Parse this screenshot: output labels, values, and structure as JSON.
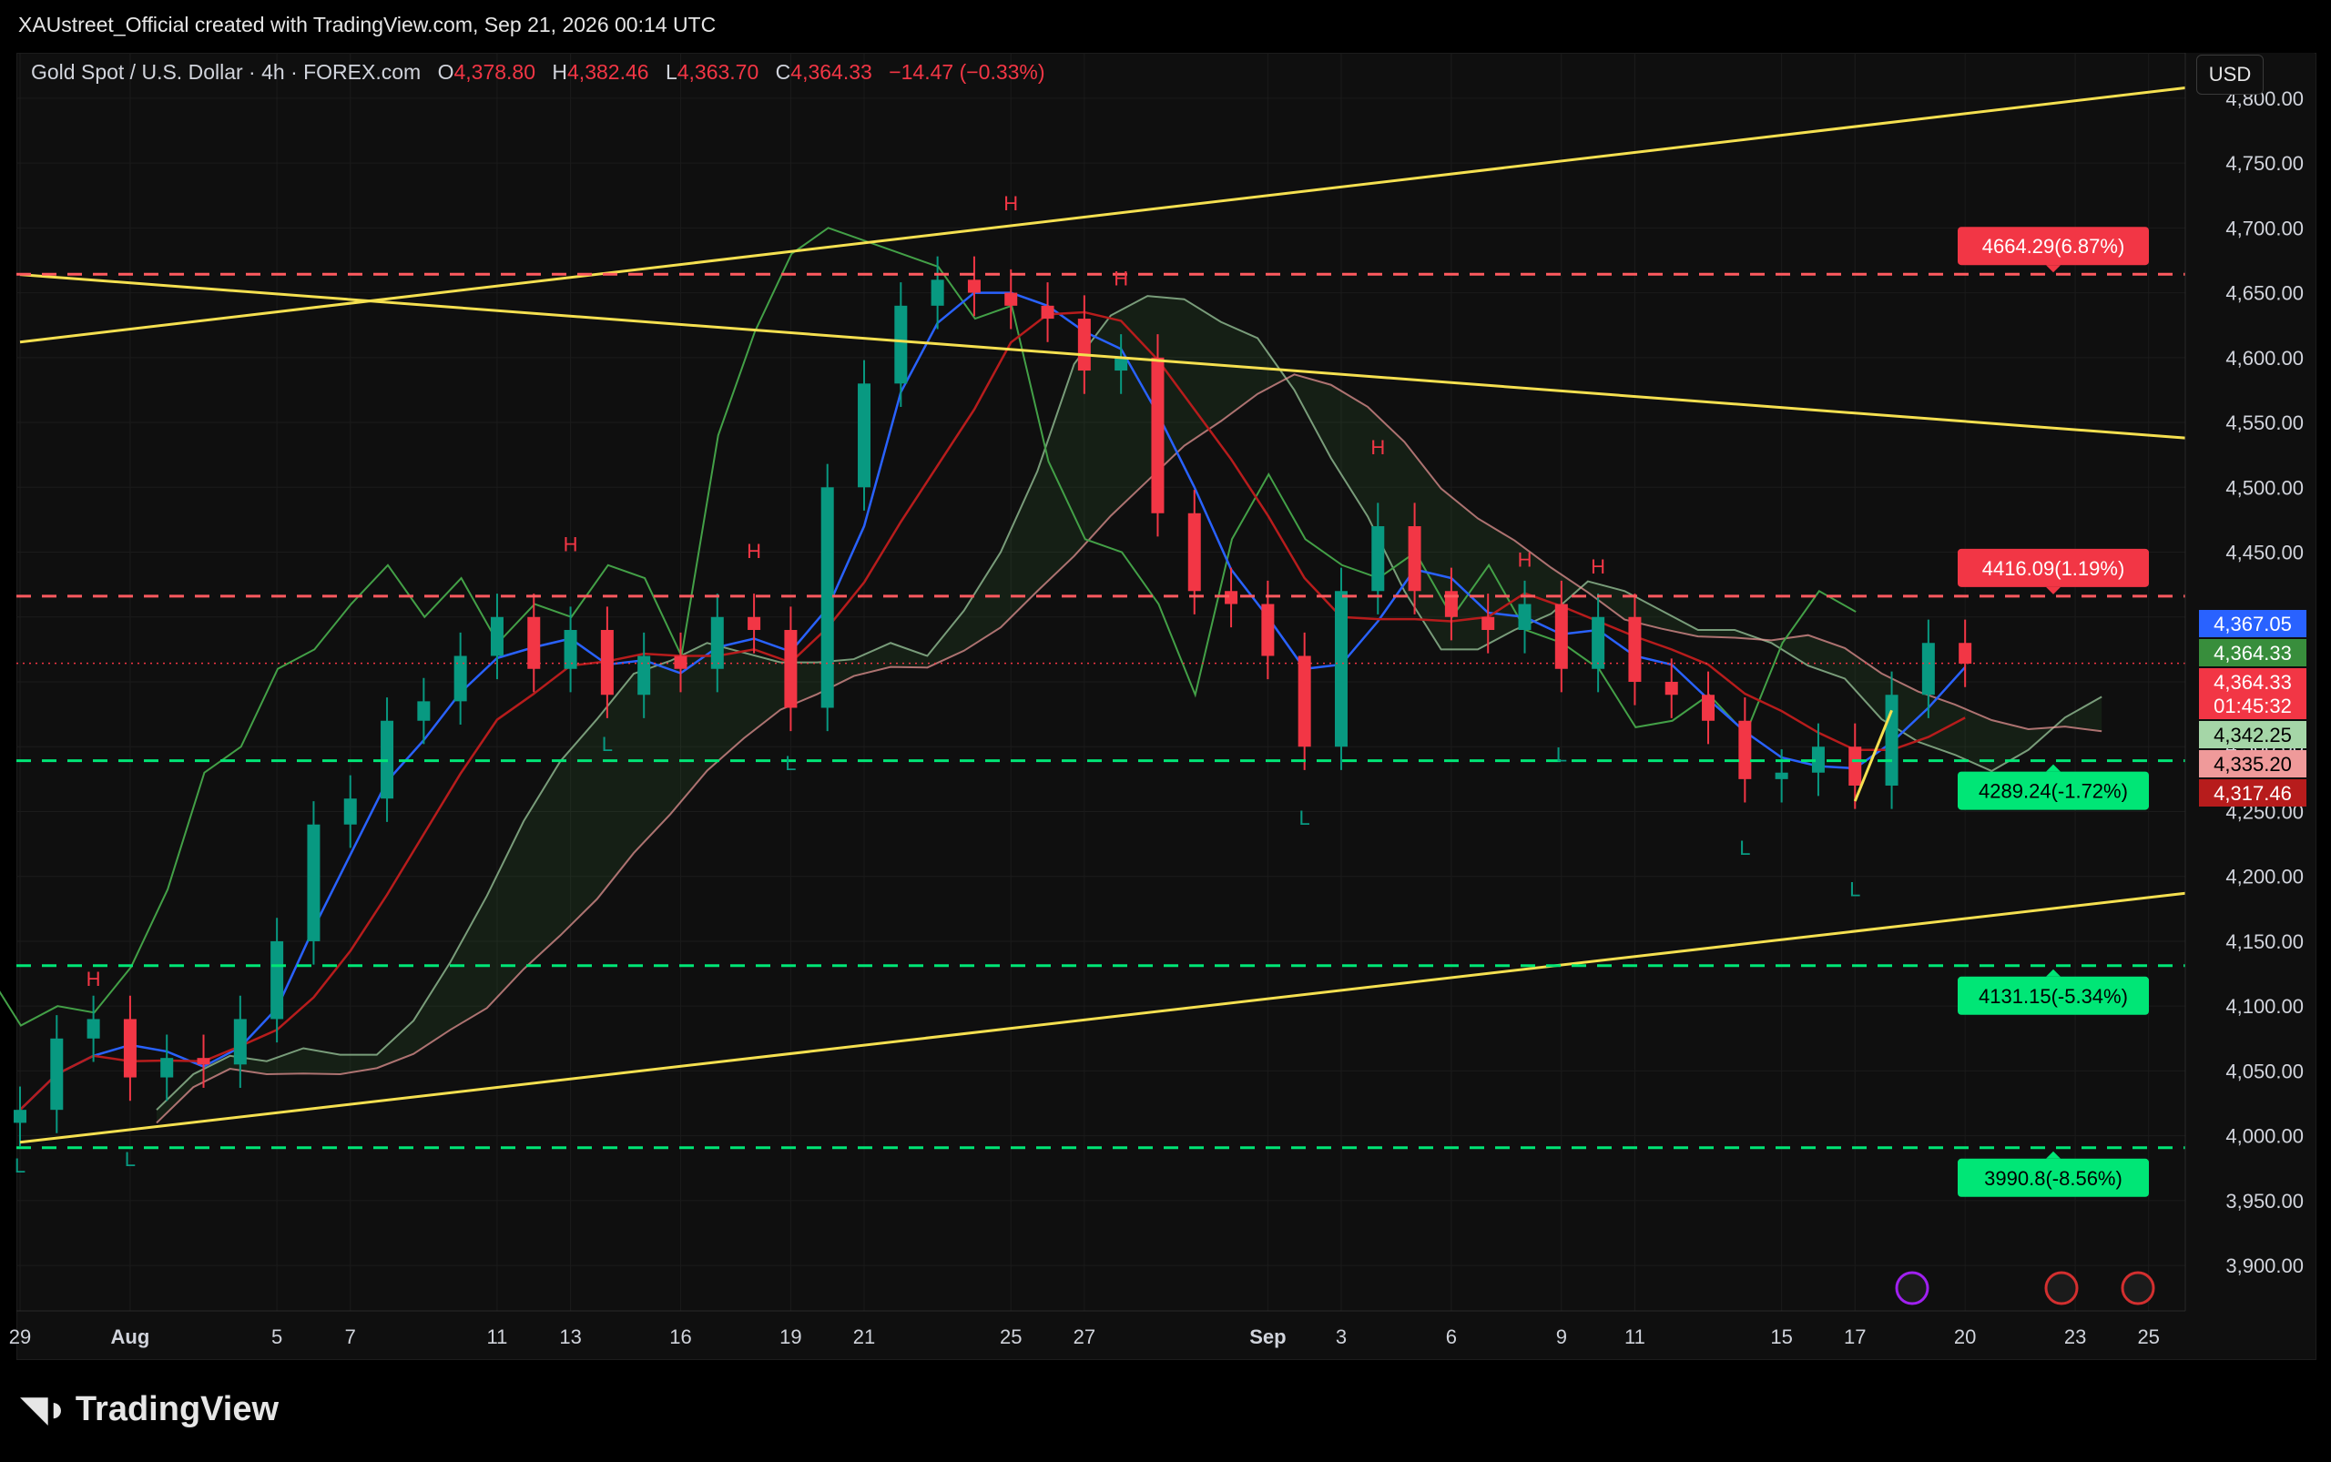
{
  "header": {
    "attribution": "XAUstreet_Official created with TradingView.com, Sep 21, 2026 00:14 UTC"
  },
  "legend": {
    "symbol": "Gold Spot / U.S. Dollar · 4h · FOREX.com",
    "o_label": "O",
    "o_value": "4,378.80",
    "h_label": "H",
    "h_value": "4,382.46",
    "l_label": "L",
    "l_value": "4,363.70",
    "c_label": "C",
    "c_value": "4,364.33",
    "change": "−14.47 (−0.33%)"
  },
  "currency": "USD",
  "footer": {
    "brand": "TradingView"
  },
  "colors": {
    "bull": "#089981",
    "bear": "#f23645",
    "trendline": "#f5e050",
    "resistance": "#ff5a5f",
    "support": "#00e676",
    "tenkan": "#2962ff",
    "kijun": "#b71c1c",
    "chikou": "#43a047"
  },
  "chart_data": {
    "type": "candlestick",
    "title": "Gold Spot / U.S. Dollar · 4h · FOREX.com",
    "ylim": [
      3865,
      4835
    ],
    "y_ticks": [
      "4,800.00",
      "4,750.00",
      "4,700.00",
      "4,650.00",
      "4,600.00",
      "4,550.00",
      "4,500.00",
      "4,450.00",
      "4,400.00",
      "4,350.00",
      "4,300.00",
      "4,250.00",
      "4,200.00",
      "4,150.00",
      "4,100.00",
      "4,050.00",
      "4,000.00",
      "3,950.00",
      "3,900.00"
    ],
    "y_tick_values": [
      4800,
      4750,
      4700,
      4650,
      4600,
      4550,
      4500,
      4450,
      4400,
      4350,
      4300,
      4250,
      4200,
      4150,
      4100,
      4050,
      4000,
      3950,
      3900
    ],
    "x_ticks": [
      {
        "label": "29",
        "date": "2026-07-29"
      },
      {
        "label": "Aug",
        "date": "2026-08-01"
      },
      {
        "label": "5",
        "date": "2026-08-05"
      },
      {
        "label": "7",
        "date": "2026-08-07"
      },
      {
        "label": "11",
        "date": "2026-08-11"
      },
      {
        "label": "13",
        "date": "2026-08-13"
      },
      {
        "label": "16",
        "date": "2026-08-16"
      },
      {
        "label": "19",
        "date": "2026-08-19"
      },
      {
        "label": "21",
        "date": "2026-08-21"
      },
      {
        "label": "25",
        "date": "2026-08-25"
      },
      {
        "label": "27",
        "date": "2026-08-27"
      },
      {
        "label": "Sep",
        "date": "2026-09-01"
      },
      {
        "label": "3",
        "date": "2026-09-03"
      },
      {
        "label": "6",
        "date": "2026-09-06"
      },
      {
        "label": "9",
        "date": "2026-09-09"
      },
      {
        "label": "11",
        "date": "2026-09-11"
      },
      {
        "label": "15",
        "date": "2026-09-15"
      },
      {
        "label": "17",
        "date": "2026-09-17"
      },
      {
        "label": "20",
        "date": "2026-09-20"
      },
      {
        "label": "23",
        "date": "2026-09-23"
      },
      {
        "label": "25",
        "date": "2026-09-25"
      }
    ],
    "price_levels": [
      {
        "price": 4664.29,
        "label": "4664.29(6.87%)",
        "kind": "resistance"
      },
      {
        "price": 4416.09,
        "label": "4416.09(1.19%)",
        "kind": "resistance"
      },
      {
        "price": 4289.24,
        "label": "4289.24(-1.72%)",
        "kind": "support"
      },
      {
        "price": 4131.15,
        "label": "4131.15(-5.34%)",
        "kind": "support"
      },
      {
        "price": 3990.8,
        "label": "3990.8(-8.56%)",
        "kind": "support"
      }
    ],
    "price_tags": [
      {
        "price": 4367.05,
        "label": "4,367.05",
        "color": "#2962ff"
      },
      {
        "price": 4364.33,
        "label": "4,364.33",
        "color": "#388e3c"
      },
      {
        "price": 4364.33,
        "label": "4,364.33",
        "sub": "01:45:32",
        "color": "#f23645"
      },
      {
        "price": 4342.25,
        "label": "4,342.25",
        "color": "#a5d6a7",
        "text": "#000"
      },
      {
        "price": 4335.2,
        "label": "4,335.20",
        "color": "#ef9a9a",
        "text": "#000"
      },
      {
        "price": 4317.46,
        "label": "4,317.46",
        "color": "#b71c1c"
      }
    ],
    "trendlines": [
      {
        "from": [
          "2026-07-29",
          4664
        ],
        "to": [
          "2026-09-26",
          4538
        ]
      },
      {
        "from": [
          "2026-07-29",
          4612
        ],
        "to": [
          "2026-09-26",
          4808
        ]
      },
      {
        "from": [
          "2026-07-29",
          3995
        ],
        "to": [
          "2026-09-26",
          4187
        ]
      },
      {
        "from": [
          "2026-09-17",
          4258
        ],
        "to": [
          "2026-09-18",
          4328
        ]
      }
    ],
    "pivots": [
      {
        "date": "2026-07-29",
        "price": 3990,
        "label": "L"
      },
      {
        "date": "2026-07-31",
        "price": 4110,
        "label": "H"
      },
      {
        "date": "2026-08-01",
        "price": 3995,
        "label": "L"
      },
      {
        "date": "2026-08-13",
        "price": 4445,
        "label": "H"
      },
      {
        "date": "2026-08-14",
        "price": 4315,
        "label": "L"
      },
      {
        "date": "2026-08-18",
        "price": 4440,
        "label": "H"
      },
      {
        "date": "2026-08-19",
        "price": 4300,
        "label": "L"
      },
      {
        "date": "2026-08-25",
        "price": 4708,
        "label": "H"
      },
      {
        "date": "2026-08-28",
        "price": 4650,
        "label": "H"
      },
      {
        "date": "2026-09-02",
        "price": 4258,
        "label": "L"
      },
      {
        "date": "2026-09-04",
        "price": 4520,
        "label": "H"
      },
      {
        "date": "2026-09-08",
        "price": 4433,
        "label": "H"
      },
      {
        "date": "2026-09-09",
        "price": 4307,
        "label": "L"
      },
      {
        "date": "2026-09-10",
        "price": 4428,
        "label": "H"
      },
      {
        "date": "2026-09-14",
        "price": 4235,
        "label": "L"
      },
      {
        "date": "2026-09-17",
        "price": 4203,
        "label": "L"
      }
    ],
    "closes": [
      {
        "date": "2026-07-29",
        "close": 4020
      },
      {
        "date": "2026-07-30",
        "close": 4075
      },
      {
        "date": "2026-07-31",
        "close": 4090
      },
      {
        "date": "2026-08-01",
        "close": 4045
      },
      {
        "date": "2026-08-02",
        "close": 4060
      },
      {
        "date": "2026-08-03",
        "close": 4055
      },
      {
        "date": "2026-08-04",
        "close": 4090
      },
      {
        "date": "2026-08-05",
        "close": 4150
      },
      {
        "date": "2026-08-06",
        "close": 4240
      },
      {
        "date": "2026-08-07",
        "close": 4260
      },
      {
        "date": "2026-08-08",
        "close": 4320
      },
      {
        "date": "2026-08-09",
        "close": 4335
      },
      {
        "date": "2026-08-10",
        "close": 4370
      },
      {
        "date": "2026-08-11",
        "close": 4400
      },
      {
        "date": "2026-08-12",
        "close": 4360
      },
      {
        "date": "2026-08-13",
        "close": 4390
      },
      {
        "date": "2026-08-14",
        "close": 4340
      },
      {
        "date": "2026-08-15",
        "close": 4370
      },
      {
        "date": "2026-08-16",
        "close": 4360
      },
      {
        "date": "2026-08-17",
        "close": 4400
      },
      {
        "date": "2026-08-18",
        "close": 4390
      },
      {
        "date": "2026-08-19",
        "close": 4330
      },
      {
        "date": "2026-08-20",
        "close": 4500
      },
      {
        "date": "2026-08-21",
        "close": 4580
      },
      {
        "date": "2026-08-22",
        "close": 4640
      },
      {
        "date": "2026-08-23",
        "close": 4660
      },
      {
        "date": "2026-08-24",
        "close": 4650
      },
      {
        "date": "2026-08-25",
        "close": 4640
      },
      {
        "date": "2026-08-26",
        "close": 4630
      },
      {
        "date": "2026-08-27",
        "close": 4590
      },
      {
        "date": "2026-08-28",
        "close": 4600
      },
      {
        "date": "2026-08-29",
        "close": 4480
      },
      {
        "date": "2026-08-30",
        "close": 4420
      },
      {
        "date": "2026-08-31",
        "close": 4410
      },
      {
        "date": "2026-09-01",
        "close": 4370
      },
      {
        "date": "2026-09-02",
        "close": 4300
      },
      {
        "date": "2026-09-03",
        "close": 4420
      },
      {
        "date": "2026-09-04",
        "close": 4470
      },
      {
        "date": "2026-09-05",
        "close": 4420
      },
      {
        "date": "2026-09-06",
        "close": 4400
      },
      {
        "date": "2026-09-07",
        "close": 4390
      },
      {
        "date": "2026-09-08",
        "close": 4410
      },
      {
        "date": "2026-09-09",
        "close": 4360
      },
      {
        "date": "2026-09-10",
        "close": 4400
      },
      {
        "date": "2026-09-11",
        "close": 4350
      },
      {
        "date": "2026-09-12",
        "close": 4340
      },
      {
        "date": "2026-09-13",
        "close": 4320
      },
      {
        "date": "2026-09-14",
        "close": 4275
      },
      {
        "date": "2026-09-15",
        "close": 4280
      },
      {
        "date": "2026-09-16",
        "close": 4300
      },
      {
        "date": "2026-09-17",
        "close": 4270
      },
      {
        "date": "2026-09-18",
        "close": 4340
      },
      {
        "date": "2026-09-19",
        "close": 4380
      },
      {
        "date": "2026-09-20",
        "close": 4364
      }
    ]
  }
}
